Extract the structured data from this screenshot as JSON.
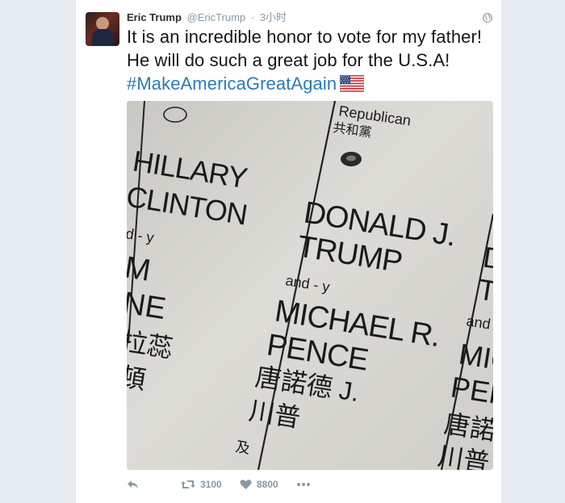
{
  "tweet": {
    "author_name": "Eric Trump",
    "author_handle": "@EricTrump",
    "separator": "·",
    "timestamp": "3小时",
    "text_main": "It is an incredible honor to vote for my father! He will do such a great job for the U.S.A! ",
    "hashtag": "#MakeAmericaGreatAgain",
    "emoji": "us-flag"
  },
  "ballot_photo": {
    "party_en": "Republican",
    "party_zh": "共和黨",
    "left_first": "HILLARY",
    "left_last": "CLINTON",
    "left_and": "d - y",
    "left_vp1": "M",
    "left_vp2": "NE",
    "left_zh1": "拉蕊",
    "left_zh2": "頓",
    "mid_first": "DONALD J.",
    "mid_last": "TRUMP",
    "mid_and": "and - y",
    "mid_vp_first": "MICHAEL R.",
    "mid_vp_last": "PENCE",
    "mid_zh1": "唐諾德 J.",
    "mid_zh2": "川普",
    "mid_zh3": "及",
    "right_1": "D",
    "right_2": "T",
    "right_and": "and",
    "right_3": "MIC",
    "right_4": "PEN",
    "right_zh1": "唐諾",
    "right_zh2": "川普"
  },
  "actions": {
    "reply_icon": "reply-icon",
    "retweet_icon": "retweet-icon",
    "retweet_count": "3100",
    "like_icon": "heart-icon",
    "like_count": "8800",
    "more_icon": "more-icon"
  },
  "colors": {
    "hashtag": "#2b7bb9",
    "meta": "#8899a6",
    "text": "#14171a",
    "background": "#e6ecf0"
  }
}
